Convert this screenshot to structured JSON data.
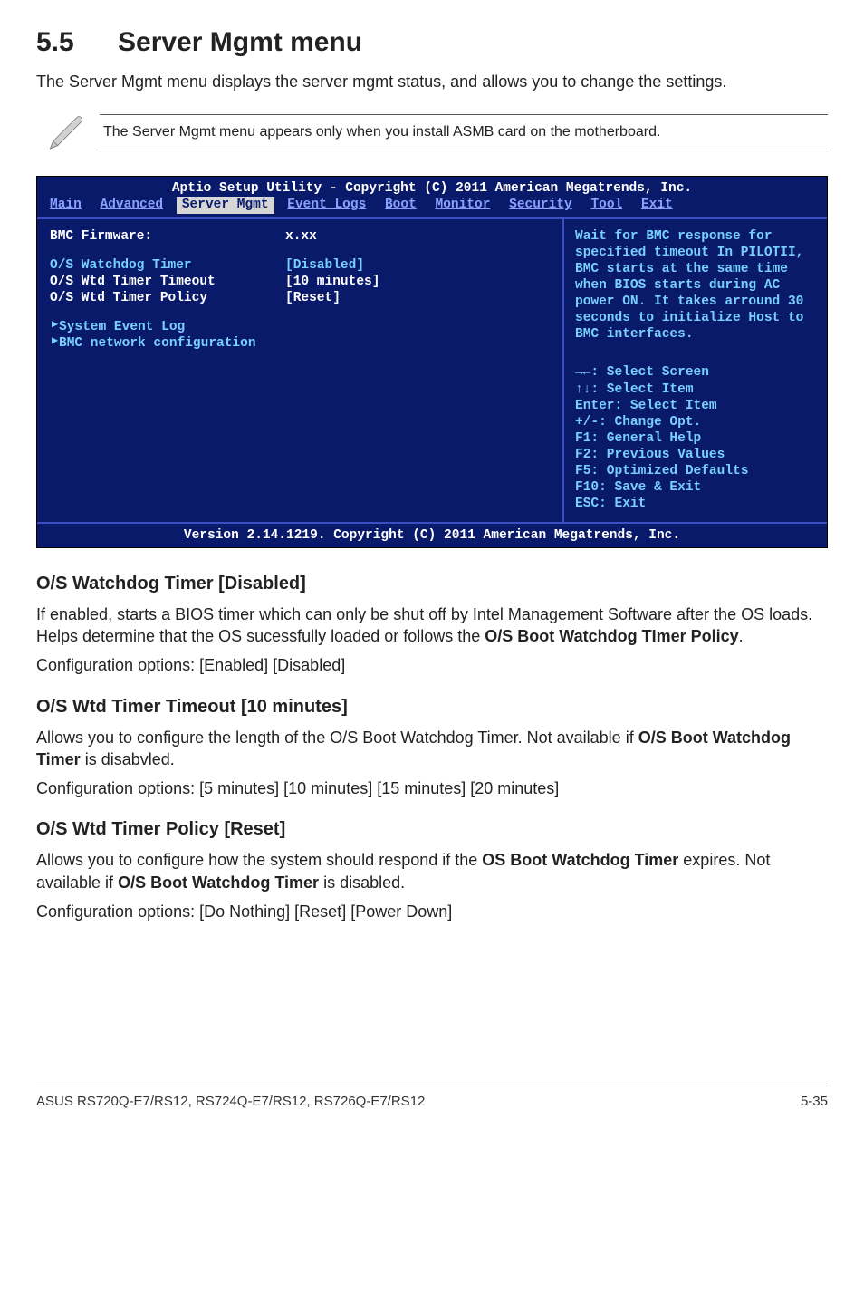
{
  "section": {
    "number": "5.5",
    "title": "Server Mgmt menu"
  },
  "intro": "The Server Mgmt menu displays the server mgmt status, and allows you to change the settings.",
  "note": "The Server Mgmt menu appears only when you install ASMB card on the motherboard.",
  "bios": {
    "title": "Aptio Setup Utility - Copyright (C) 2011 American Megatrends, Inc.",
    "tabs": {
      "main": "Main",
      "advanced": "Advanced",
      "server_mgmt": "Server Mgmt",
      "event_logs": "Event Logs",
      "boot": "Boot",
      "monitor": "Monitor",
      "security": "Security",
      "tool": "Tool",
      "exit": "Exit"
    },
    "rows": {
      "r0": {
        "label": "BMC Firmware:",
        "value": "x.xx"
      },
      "r1": {
        "label": "O/S Watchdog Timer",
        "value": "[Disabled]"
      },
      "r2": {
        "label": "O/S Wtd Timer Timeout",
        "value": "[10 minutes]"
      },
      "r3": {
        "label": "O/S Wtd Timer Policy",
        "value": "[Reset]"
      },
      "r4": {
        "label": "System Event Log"
      },
      "r5": {
        "label": "BMC network configuration"
      }
    },
    "help": "Wait for BMC response for specified timeout In PILOTII, BMC starts at the same time when BIOS starts during AC power ON. It takes arround 30 seconds to initialize Host to BMC interfaces.",
    "keys": {
      "k0": "→←: Select Screen",
      "k1": "↑↓:  Select Item",
      "k2": "Enter: Select Item",
      "k3": "+/-: Change Opt.",
      "k4": "F1: General Help",
      "k5": "F2: Previous Values",
      "k6": "F5: Optimized Defaults",
      "k7": "F10: Save & Exit",
      "k8": "ESC: Exit"
    },
    "bottom": "Version 2.14.1219. Copyright (C) 2011 American Megatrends, Inc."
  },
  "s1": {
    "h": "O/S Watchdog Timer [Disabled]",
    "p1_a": "If enabled, starts a BIOS timer which can only be shut off by Intel Management Software after the OS loads. Helps determine that the OS sucessfully loaded or follows the ",
    "p1_b": "O/S Boot Watchdog TImer Policy",
    "p1_c": ".",
    "p2": "Configuration options: [Enabled] [Disabled]"
  },
  "s2": {
    "h": "O/S Wtd Timer Timeout [10 minutes]",
    "p1_a": "Allows you to configure the length of the O/S Boot Watchdog Timer. Not available if ",
    "p1_b": "O/S Boot Watchdog Timer",
    "p1_c": " is disabvled.",
    "p2": "Configuration options: [5 minutes] [10 minutes] [15 minutes] [20 minutes]"
  },
  "s3": {
    "h": "O/S Wtd Timer Policy [Reset]",
    "p1_a": "Allows you to configure how the system should respond if the ",
    "p1_b": "OS Boot Watchdog Timer",
    "p1_c": " expires. Not available if ",
    "p1_d": "O/S Boot Watchdog Timer",
    "p1_e": " is disabled.",
    "p2": "Configuration options: [Do Nothing] [Reset] [Power Down]"
  },
  "footer": {
    "left": "ASUS RS720Q-E7/RS12, RS724Q-E7/RS12, RS726Q-E7/RS12",
    "right": "5-35"
  }
}
